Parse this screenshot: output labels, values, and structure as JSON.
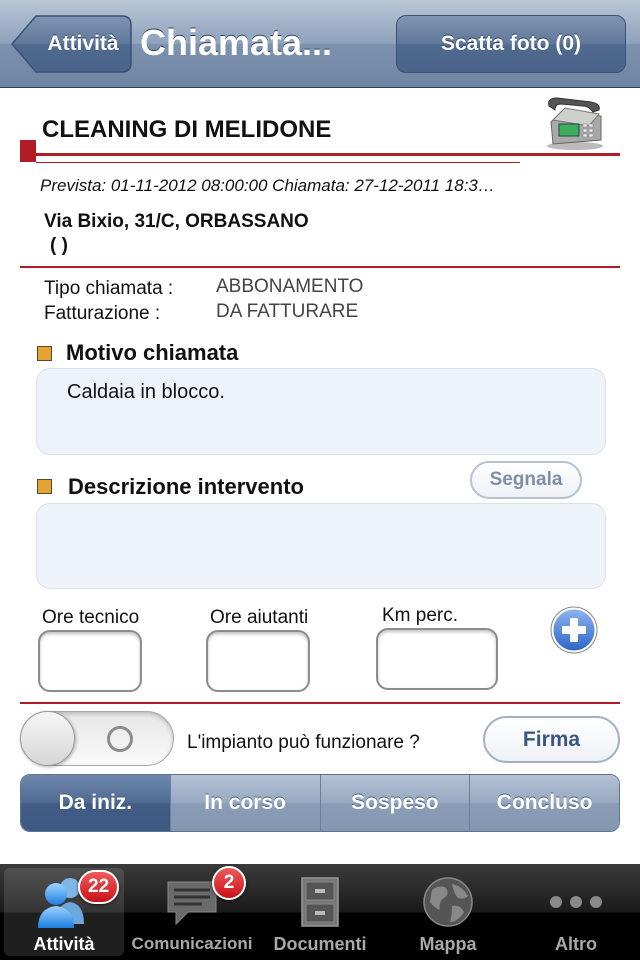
{
  "navbar": {
    "back_label": "Attività",
    "title": "Chiamata...",
    "right_button": "Scatta foto (0)"
  },
  "header": {
    "title": "CLEANING DI MELIDONE",
    "dates": "Prevista: 01-11-2012 08:00:00  Chiamata: 27-12-2011 18:3…",
    "address_line1": "Via Bixio, 31/C, ORBASSANO",
    "address_line2": "(    )"
  },
  "info": {
    "tipo_label": "Tipo chiamata :",
    "tipo_value": "ABBONAMENTO",
    "fatt_label": "Fatturazione :",
    "fatt_value": "DA FATTURARE"
  },
  "motivo": {
    "title": "Motivo chiamata",
    "value": "Caldaia in blocco."
  },
  "descrizione": {
    "title": "Descrizione intervento",
    "value": "",
    "segnala_label": "Segnala"
  },
  "hours": {
    "ore_tecnico_label": "Ore tecnico",
    "ore_aiutanti_label": "Ore aiutanti",
    "km_label": "Km perc."
  },
  "impianto": {
    "label": "L'impianto può funzionare ?",
    "firma_label": "Firma"
  },
  "status_segments": [
    {
      "label": "Da iniz.",
      "active": true
    },
    {
      "label": "In corso",
      "active": false
    },
    {
      "label": "Sospeso",
      "active": false
    },
    {
      "label": "Concluso",
      "active": false
    }
  ],
  "tabbar": [
    {
      "label": "Attività",
      "badge": "22",
      "icon": "people-icon",
      "active": true
    },
    {
      "label": "Comunicazioni",
      "badge": "2",
      "icon": "chat-bubble-icon",
      "active": false
    },
    {
      "label": "Documenti",
      "badge": "",
      "icon": "cabinet-icon",
      "active": false
    },
    {
      "label": "Mappa",
      "badge": "",
      "icon": "globe-icon",
      "active": false
    },
    {
      "label": "Altro",
      "badge": "",
      "icon": "more-icon",
      "active": false
    }
  ],
  "colors": {
    "accent_red": "#b21d25",
    "nav_blue": "#6e85a3",
    "section_square": "#e3a434"
  }
}
